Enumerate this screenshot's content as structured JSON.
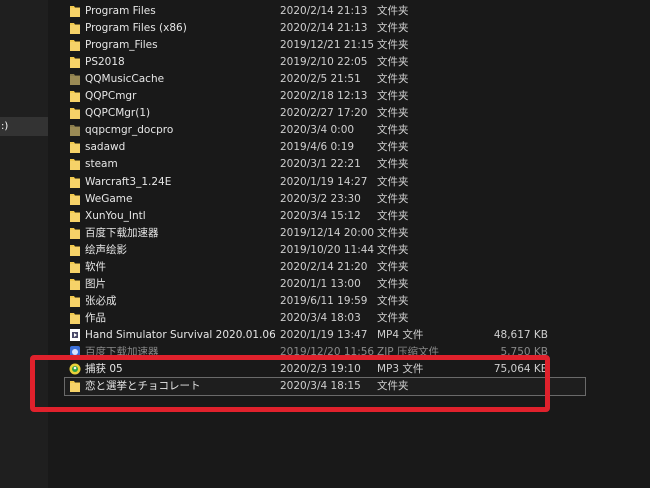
{
  "navigation": {
    "selected_item_fragment": ":)"
  },
  "files": [
    {
      "name": "Program Files",
      "date": "2020/2/14 21:13",
      "type": "文件夹",
      "size": "",
      "icon": "folder-icon"
    },
    {
      "name": "Program Files (x86)",
      "date": "2020/2/14 21:13",
      "type": "文件夹",
      "size": "",
      "icon": "folder-icon"
    },
    {
      "name": "Program_Files",
      "date": "2019/12/21 21:15",
      "type": "文件夹",
      "size": "",
      "icon": "folder-icon"
    },
    {
      "name": "PS2018",
      "date": "2019/2/10 22:05",
      "type": "文件夹",
      "size": "",
      "icon": "folder-icon"
    },
    {
      "name": "QQMusicCache",
      "date": "2020/2/5 21:51",
      "type": "文件夹",
      "size": "",
      "icon": "folder-dim-icon"
    },
    {
      "name": "QQPCmgr",
      "date": "2020/2/18 12:13",
      "type": "文件夹",
      "size": "",
      "icon": "folder-icon"
    },
    {
      "name": "QQPCMgr(1)",
      "date": "2020/2/27 17:20",
      "type": "文件夹",
      "size": "",
      "icon": "folder-icon"
    },
    {
      "name": "qqpcmgr_docpro",
      "date": "2020/3/4 0:00",
      "type": "文件夹",
      "size": "",
      "icon": "folder-dim-icon"
    },
    {
      "name": "sadawd",
      "date": "2019/4/6 0:19",
      "type": "文件夹",
      "size": "",
      "icon": "folder-icon"
    },
    {
      "name": "steam",
      "date": "2020/3/1 22:21",
      "type": "文件夹",
      "size": "",
      "icon": "folder-icon"
    },
    {
      "name": "Warcraft3_1.24E",
      "date": "2020/1/19 14:27",
      "type": "文件夹",
      "size": "",
      "icon": "folder-icon"
    },
    {
      "name": "WeGame",
      "date": "2020/3/2 23:30",
      "type": "文件夹",
      "size": "",
      "icon": "folder-icon"
    },
    {
      "name": "XunYou_Intl",
      "date": "2020/3/4 15:12",
      "type": "文件夹",
      "size": "",
      "icon": "folder-icon"
    },
    {
      "name": "百度下载加速器",
      "date": "2019/12/14 20:00",
      "type": "文件夹",
      "size": "",
      "icon": "folder-icon"
    },
    {
      "name": "绘声绘影",
      "date": "2019/10/20 11:44",
      "type": "文件夹",
      "size": "",
      "icon": "folder-icon"
    },
    {
      "name": "软件",
      "date": "2020/2/14 21:20",
      "type": "文件夹",
      "size": "",
      "icon": "folder-icon"
    },
    {
      "name": "图片",
      "date": "2020/1/1 13:00",
      "type": "文件夹",
      "size": "",
      "icon": "folder-icon"
    },
    {
      "name": "张必成",
      "date": "2019/6/11 19:59",
      "type": "文件夹",
      "size": "",
      "icon": "folder-icon"
    },
    {
      "name": "作品",
      "date": "2020/3/4 18:03",
      "type": "文件夹",
      "size": "",
      "icon": "folder-icon"
    },
    {
      "name": "Hand Simulator Survival 2020.01.06 - ...",
      "date": "2020/1/19 13:47",
      "type": "MP4 文件",
      "size": "48,617 KB",
      "icon": "video-file-icon"
    },
    {
      "name": "百度下载加速器",
      "date": "2019/12/20 11:56",
      "type": "ZIP 压缩文件",
      "size": "5,750 KB",
      "icon": "zip-file-icon",
      "faded": true
    },
    {
      "name": "捕获 05",
      "date": "2020/2/3 19:10",
      "type": "MP3 文件",
      "size": "75,064 KB",
      "icon": "audio-file-icon"
    },
    {
      "name": "恋と選挙とチョコレート",
      "date": "2020/3/4 18:15",
      "type": "文件夹",
      "size": "",
      "icon": "folder-icon",
      "selected": true
    }
  ],
  "colors": {
    "folder": "#f2c94c",
    "folder_dim": "#9a8a55",
    "highlight_box": "#e0212c"
  }
}
